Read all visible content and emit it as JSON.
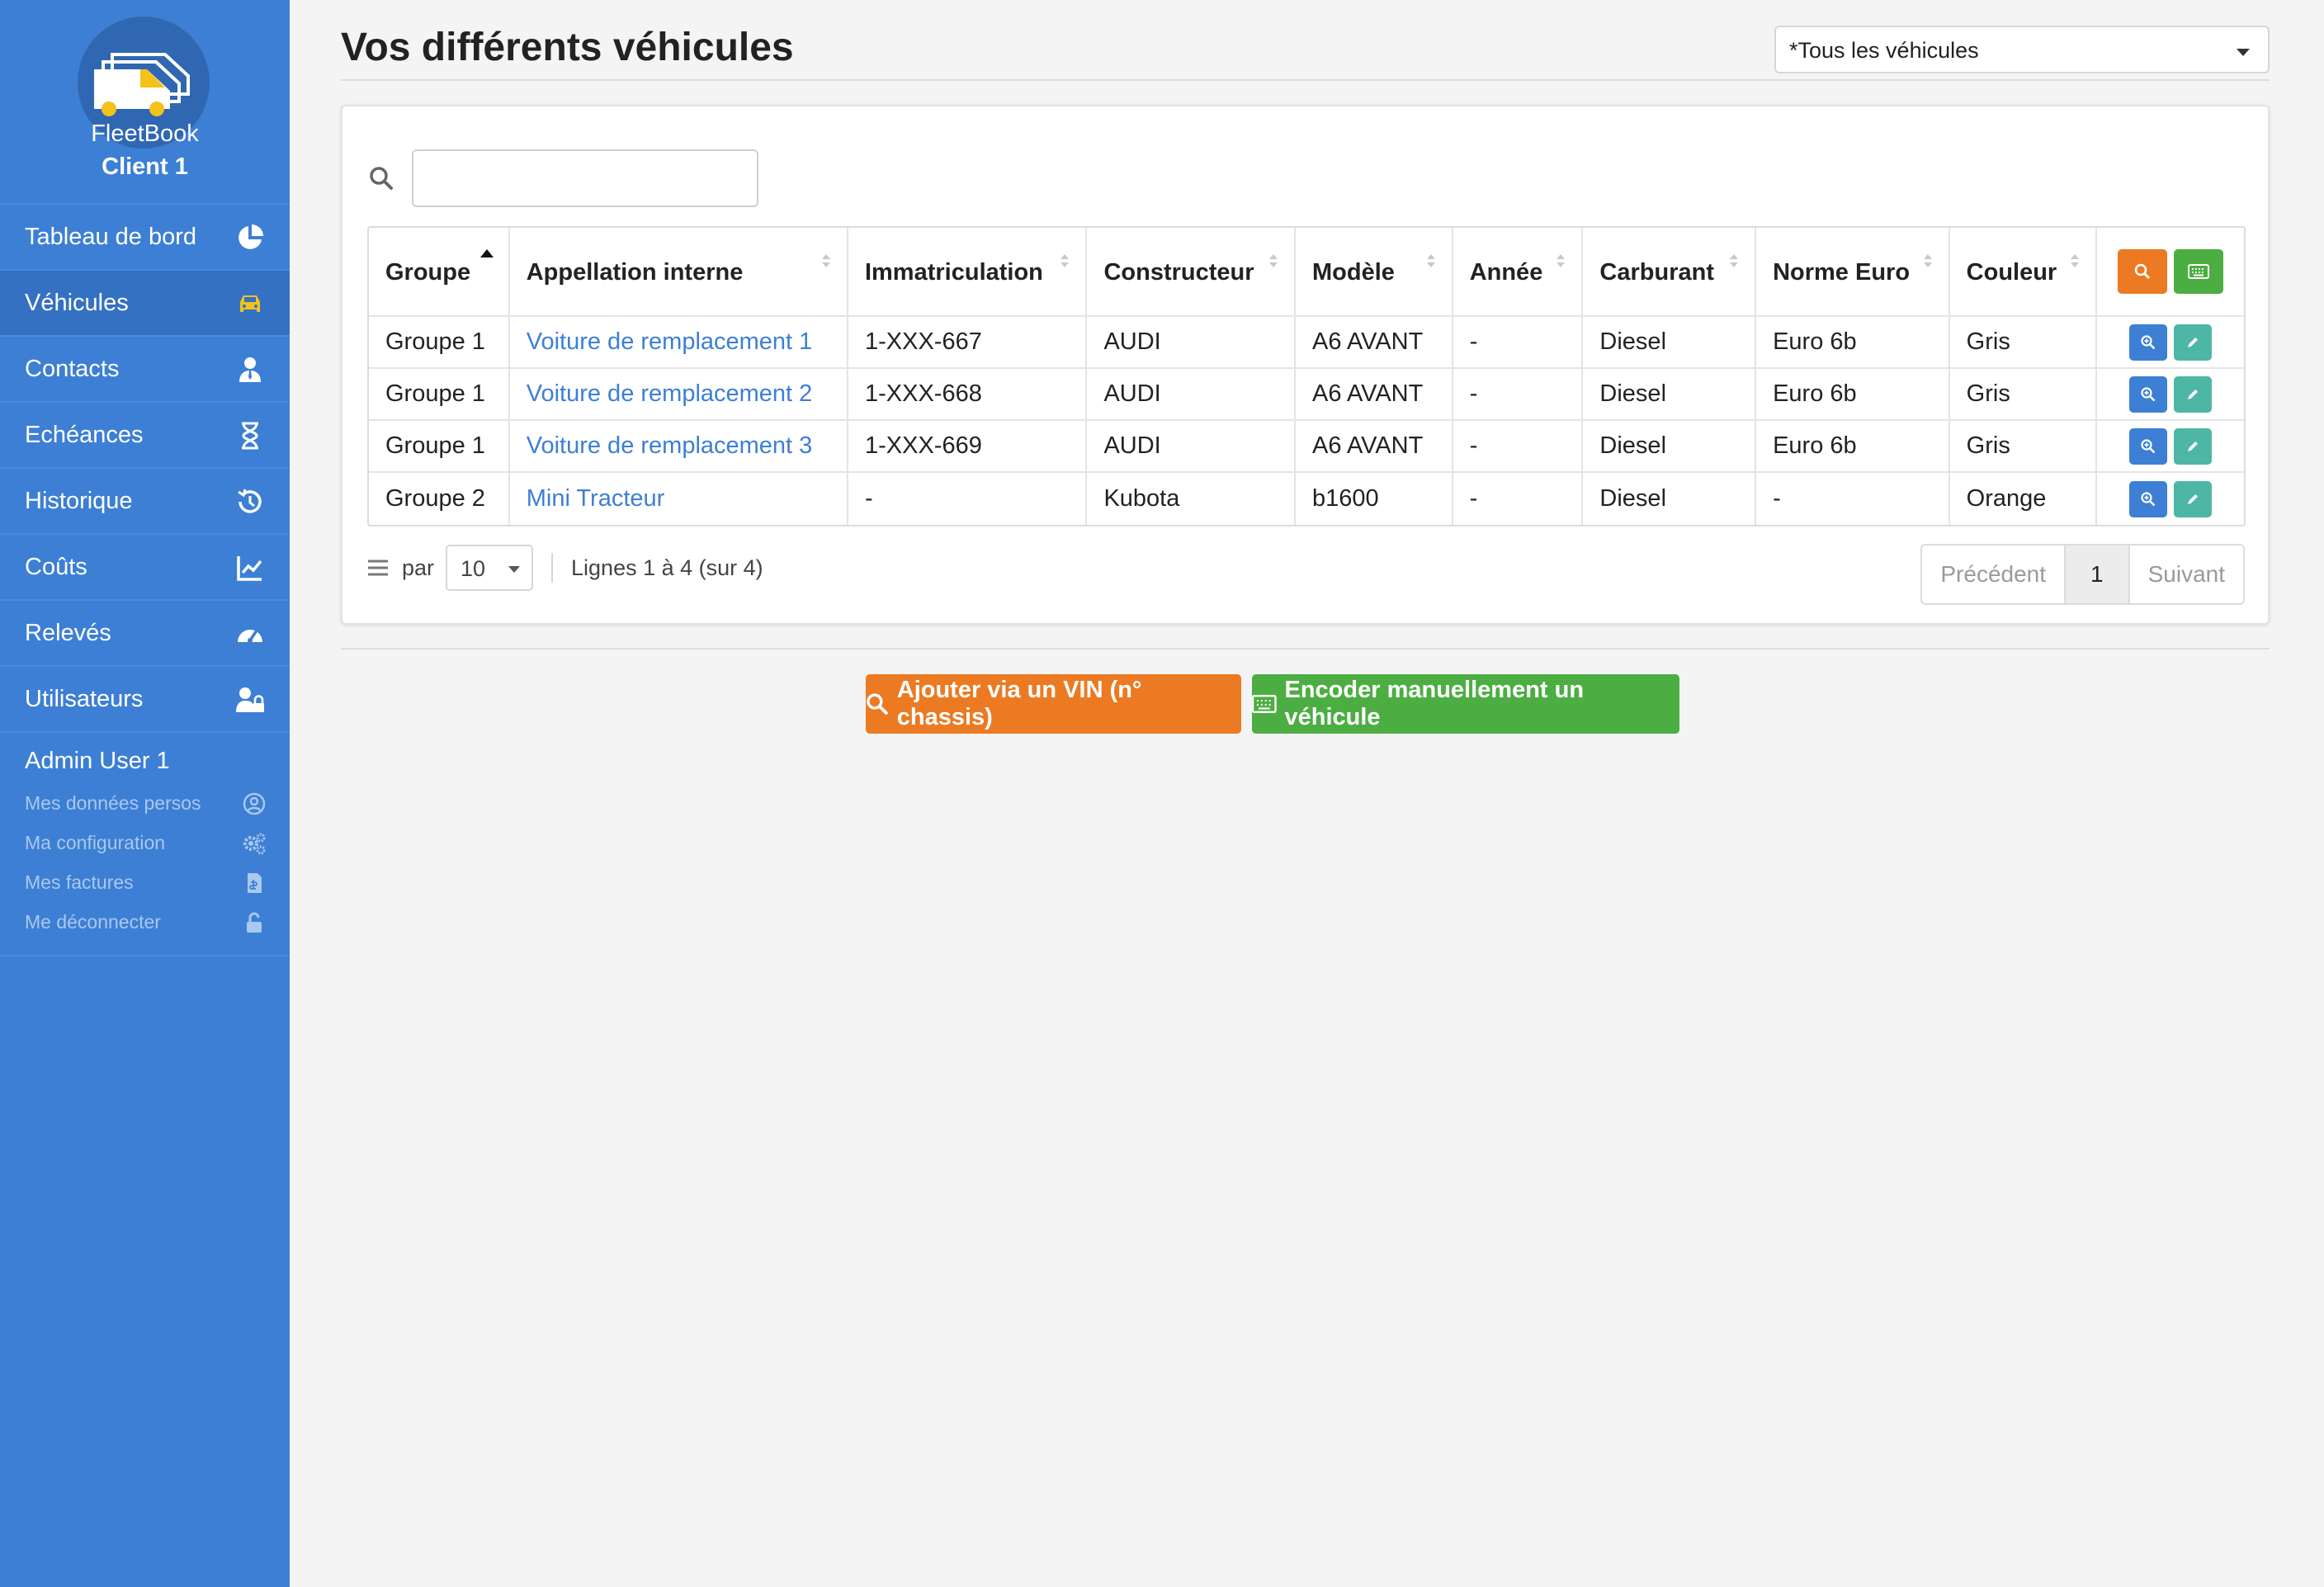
{
  "brand": {
    "line1": "FleetBook",
    "line2": "Client 1"
  },
  "sidebar": {
    "items": [
      {
        "label": "Tableau de bord",
        "icon": "pie-chart-icon"
      },
      {
        "label": "Véhicules",
        "icon": "car-icon",
        "active": true
      },
      {
        "label": "Contacts",
        "icon": "user-tie-icon"
      },
      {
        "label": "Echéances",
        "icon": "hourglass-icon"
      },
      {
        "label": "Historique",
        "icon": "history-icon"
      },
      {
        "label": "Coûts",
        "icon": "line-chart-icon"
      },
      {
        "label": "Relevés",
        "icon": "gauge-icon"
      },
      {
        "label": "Utilisateurs",
        "icon": "users-lock-icon"
      }
    ],
    "admin": {
      "name": "Admin User 1",
      "links": [
        {
          "label": "Mes données persos",
          "icon": "user-circle-icon"
        },
        {
          "label": "Ma configuration",
          "icon": "cogs-icon"
        },
        {
          "label": "Mes factures",
          "icon": "invoice-icon"
        },
        {
          "label": "Me déconnecter",
          "icon": "unlock-icon"
        }
      ]
    }
  },
  "page": {
    "title": "Vos différents véhicules",
    "filter_select": "*Tous les véhicules"
  },
  "table": {
    "search_value": "",
    "columns": [
      "Groupe",
      "Appellation interne",
      "Immatriculation",
      "Constructeur",
      "Modèle",
      "Année",
      "Carburant",
      "Norme Euro",
      "Couleur"
    ],
    "rows": [
      [
        "Groupe 1",
        "Voiture de remplacement 1",
        "1-XXX-667",
        "AUDI",
        "A6 AVANT",
        "-",
        "Diesel",
        "Euro 6b",
        "Gris"
      ],
      [
        "Groupe 1",
        "Voiture de remplacement 2",
        "1-XXX-668",
        "AUDI",
        "A6 AVANT",
        "-",
        "Diesel",
        "Euro 6b",
        "Gris"
      ],
      [
        "Groupe 1",
        "Voiture de remplacement 3",
        "1-XXX-669",
        "AUDI",
        "A6 AVANT",
        "-",
        "Diesel",
        "Euro 6b",
        "Gris"
      ],
      [
        "Groupe 2",
        "Mini Tracteur",
        "-",
        "Kubota",
        "b1600",
        "-",
        "Diesel",
        "-",
        "Orange"
      ]
    ],
    "per_page_label": "par",
    "per_page_value": "10",
    "rows_info": "Lignes 1 à 4 (sur 4)",
    "pagination": {
      "prev": "Précédent",
      "current": "1",
      "next": "Suivant"
    }
  },
  "actions": {
    "vin": "Ajouter via un VIN (n° chassis)",
    "manual": "Encoder manuellement un véhicule"
  },
  "colors": {
    "sidebar": "#3d7fd4",
    "accent_orange": "#eb7a22",
    "accent_green": "#4cae42",
    "accent_teal": "#4db6a5",
    "link": "#3d7fd4"
  }
}
